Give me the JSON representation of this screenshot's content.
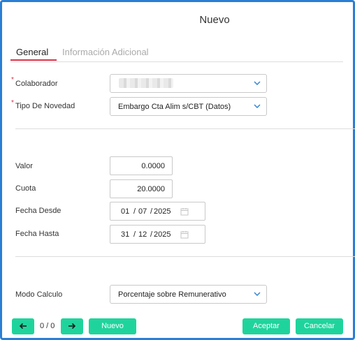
{
  "dialog": {
    "title": "Nuevo"
  },
  "tabs": [
    {
      "label": "General",
      "active": true
    },
    {
      "label": "Información Adicional",
      "active": false
    }
  ],
  "fields": {
    "colaborador": {
      "label": "Colaborador",
      "required_mark": "*",
      "value": ""
    },
    "tipo_novedad": {
      "label": "Tipo De Novedad",
      "required_mark": "*",
      "value": "Embargo Cta Alim s/CBT (Datos)"
    },
    "valor": {
      "label": "Valor",
      "value": "0.0000"
    },
    "cuota": {
      "label": "Cuota",
      "value": "20.0000"
    },
    "fecha_desde": {
      "label": "Fecha Desde",
      "day": "01",
      "month": "07",
      "year": "2025",
      "sep": "/"
    },
    "fecha_hasta": {
      "label": "Fecha Hasta",
      "day": "31",
      "month": "12",
      "year": "2025",
      "sep": "/"
    },
    "modo_calculo": {
      "label": "Modo Calculo",
      "value": "Porcentaje sobre Remunerativo"
    }
  },
  "footer": {
    "pager_text": "0 / 0",
    "nuevo_label": "Nuevo",
    "aceptar_label": "Aceptar",
    "cancelar_label": "Cancelar"
  },
  "colors": {
    "primary_button": "#1fd49c",
    "active_tab_underline": "#d9334a",
    "dialog_border": "#2a7fd4",
    "required": "#d9334a"
  },
  "icons": [
    "chevron-down-icon",
    "calendar-icon",
    "arrow-left-icon",
    "arrow-right-icon"
  ]
}
